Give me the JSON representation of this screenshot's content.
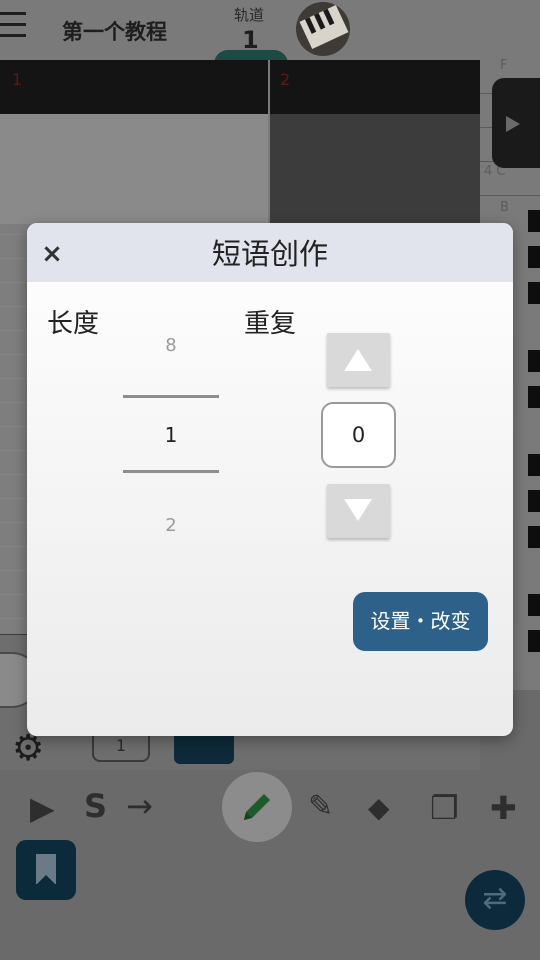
{
  "app": {
    "project_title": "第一个教程",
    "track_label": "轨道",
    "track_number": "1",
    "measures": [
      "1",
      "2"
    ],
    "piano_notes": [
      "F",
      "4 C",
      "B"
    ],
    "stepper_value": "1",
    "add_symbol": "+",
    "toolbar": {
      "play": "▶",
      "solo": "S",
      "arrow": "→",
      "eraser": "◆",
      "copy": "❐",
      "tool": "✚",
      "swap": "⇄"
    }
  },
  "dialog": {
    "title": "短语创作",
    "close": "×",
    "length_label": "长度",
    "repeat_label": "重复",
    "length_picker": {
      "prev": "8",
      "current": "1",
      "next": "2"
    },
    "repeat_value": "0",
    "apply_button": "设置・改变"
  },
  "colors": {
    "dialog_header": "#e1e4ec",
    "apply_button": "#2d6189",
    "overlay": "#6a6a6a"
  }
}
